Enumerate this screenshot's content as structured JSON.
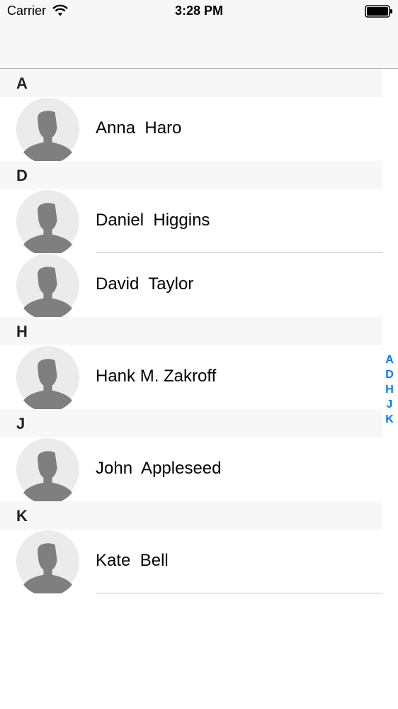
{
  "status_bar": {
    "carrier": "Carrier",
    "time": "3:28 PM",
    "wifi_icon": "wifi-icon",
    "battery_icon": "battery-icon"
  },
  "colors": {
    "accent": "#007aff",
    "section_header_bg": "#f7f7f7",
    "avatar_bg": "#ebebeb",
    "avatar_silhouette": "#7f7f7f",
    "separator": "#c8c7cc"
  },
  "sections": [
    {
      "letter": "A",
      "contacts": [
        {
          "name": "Anna  Haro",
          "avatar_icon": "avatar-placeholder-icon"
        }
      ]
    },
    {
      "letter": "D",
      "contacts": [
        {
          "name": "Daniel  Higgins",
          "avatar_icon": "avatar-placeholder-icon"
        },
        {
          "name": "David  Taylor",
          "avatar_icon": "avatar-placeholder-icon"
        }
      ]
    },
    {
      "letter": "H",
      "contacts": [
        {
          "name": "Hank M. Zakroff",
          "avatar_icon": "avatar-placeholder-icon"
        }
      ]
    },
    {
      "letter": "J",
      "contacts": [
        {
          "name": "John  Appleseed",
          "avatar_icon": "avatar-placeholder-icon"
        }
      ]
    },
    {
      "letter": "K",
      "contacts": [
        {
          "name": "Kate  Bell",
          "avatar_icon": "avatar-placeholder-icon"
        }
      ]
    }
  ],
  "section_index": [
    "A",
    "D",
    "H",
    "J",
    "K"
  ]
}
